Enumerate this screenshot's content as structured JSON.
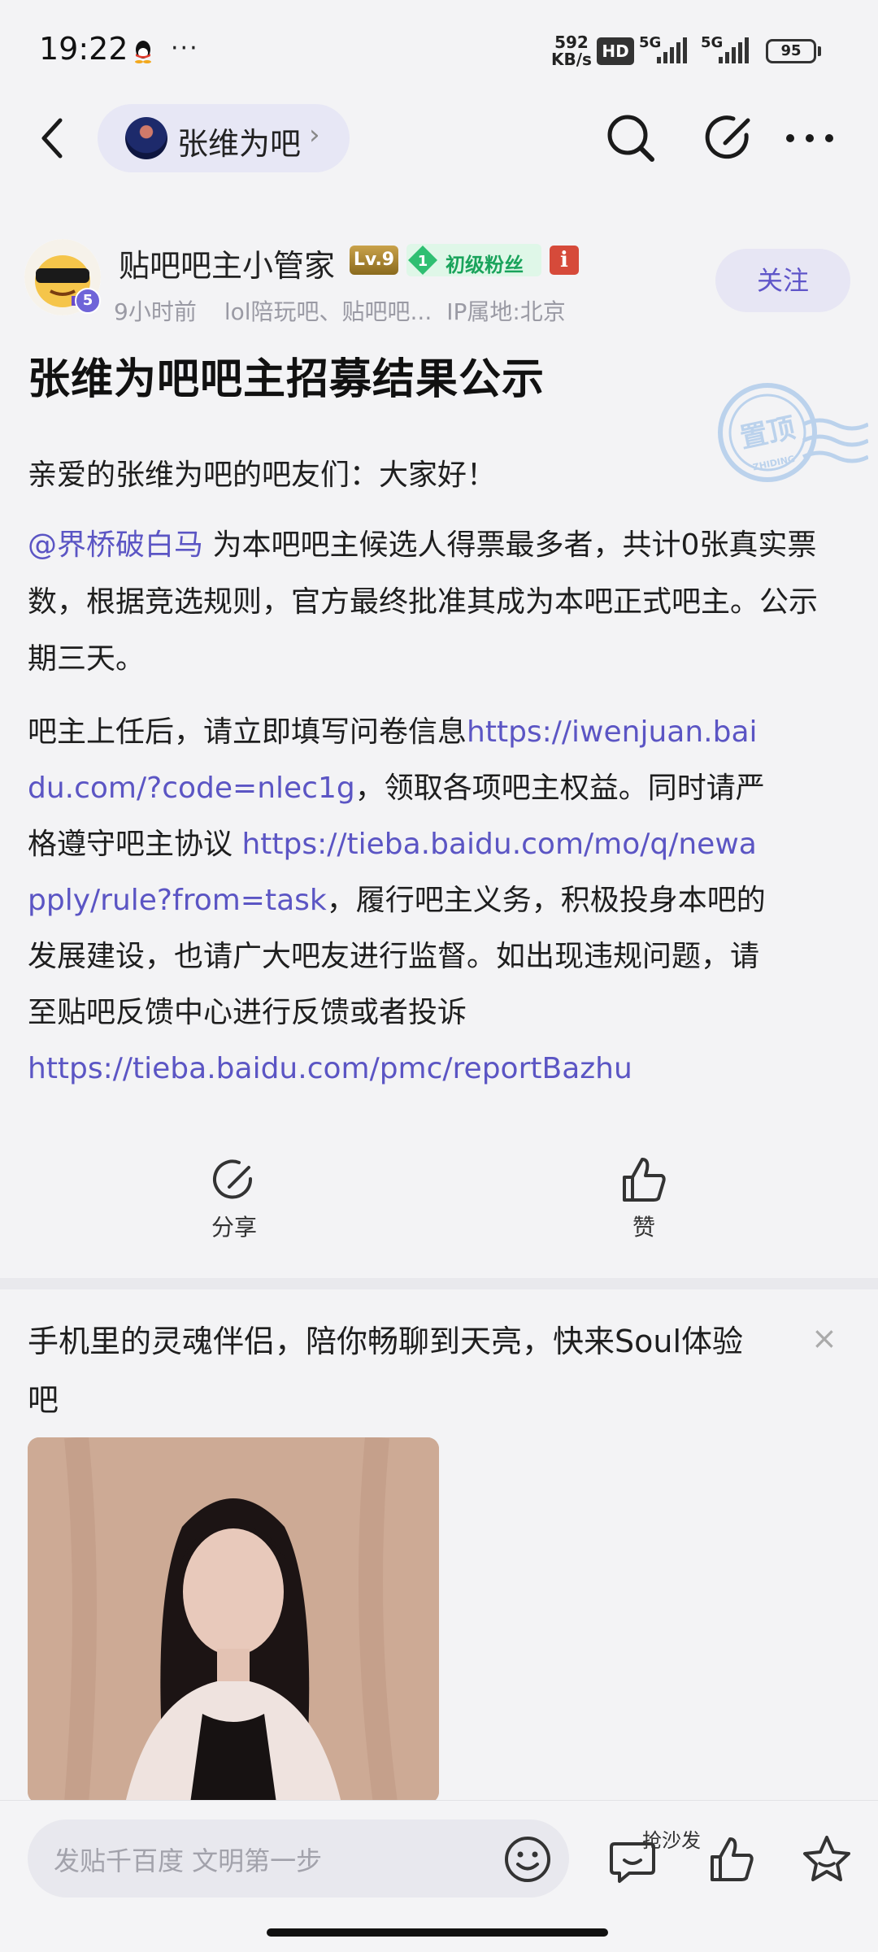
{
  "status_bar": {
    "time": "19:22",
    "dots": "···",
    "net_speed_value": "592",
    "net_speed_unit": "KB/s",
    "hd": "HD",
    "sig1_label": "5G",
    "sig2_label": "5G",
    "battery": "95"
  },
  "nav": {
    "forum_name": "张维为吧",
    "chevron": "›"
  },
  "author": {
    "name": "贴吧吧主小管家",
    "level": "Lv.9",
    "fan_level": "1",
    "fan_badge": "初级粉丝",
    "info_badge": "i",
    "time_ago": "9小时前",
    "source": "lol陪玩吧、贴吧吧...",
    "ip": "IP属地:北京",
    "follow": "关注",
    "avatar_badge": "5"
  },
  "post": {
    "title": "张维为吧吧主招募结果公示",
    "greeting": "亲爱的张维为吧的吧友们：大家好！",
    "mention": "@界桥破白马",
    "p1_rest": " 为本吧吧主候选人得票最多者，共计0张真实票数，根据竞选规则，官方最终批准其成为本吧正式吧主。公示期三天。",
    "p2_a": "吧主上任后，请立即填写问卷信息",
    "link1": "https://iwenjuan.baidu.com/?code=nlec1g",
    "p2_b": "，领取各项吧主权益。同时请严格遵守吧主协议 ",
    "link2": "https://tieba.baidu.com/mo/q/newapply/rule?from=task",
    "p2_c": "，履行吧主义务，积极投身本吧的发展建设，也请广大吧友进行监督。如出现违规问题，请至贴吧反馈中心进行反馈或者投诉",
    "link3": "https://tieba.baidu.com/pmc/reportBazhu"
  },
  "stamp": {
    "text": "置顶",
    "sub": "ZHIDING"
  },
  "actions": {
    "share": "分享",
    "like": "赞"
  },
  "ad": {
    "text": "手机里的灵魂伴侣，陪你畅聊到天亮，快来Soul体验吧",
    "close": "×"
  },
  "bottom_bar": {
    "placeholder": "发贴千百度 文明第一步",
    "sofa": "抢沙发"
  },
  "colors": {
    "accent": "#5b55c4",
    "link": "#5b55c4",
    "fan_green": "#19a35b",
    "background": "#f3f3f5"
  },
  "icons": [
    "qq-icon",
    "back-arrow-icon",
    "search-icon",
    "edit-icon",
    "more-icon",
    "share-icon",
    "like-icon",
    "emoji-icon",
    "comment-icon",
    "star-icon",
    "close-icon"
  ]
}
